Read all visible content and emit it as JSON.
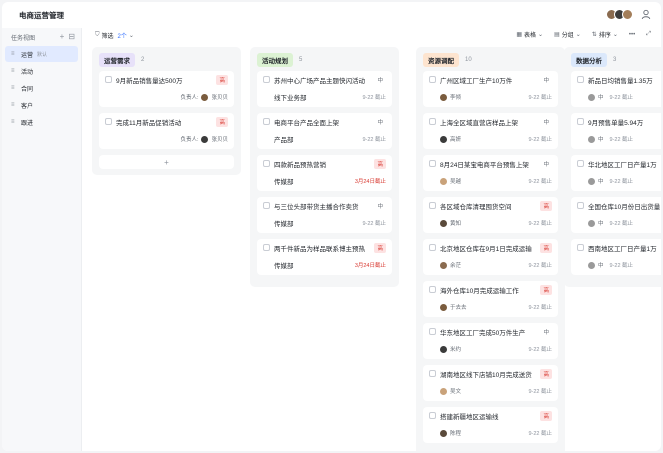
{
  "app": {
    "title": "电商运营管理"
  },
  "header": {
    "user_icon": "user-icon"
  },
  "sidebar": {
    "title": "任务视图",
    "items": [
      {
        "label": "运营",
        "badge": "默认",
        "active": true
      },
      {
        "label": "活动"
      },
      {
        "label": "合同"
      },
      {
        "label": "客户"
      },
      {
        "label": "跟进"
      }
    ]
  },
  "toolbar": {
    "filter_label": "筛选",
    "filter_count": "2个",
    "view_label": "表格",
    "group_label": "分组",
    "sort_label": "排序"
  },
  "columns": [
    {
      "tag": "运营需求",
      "count": "2",
      "tag_color": "#e7e1f9",
      "cards": [
        {
          "title": "9月新品销售量达500万",
          "priority": "高",
          "owner_label": "负责人:",
          "owner": "张贝贝"
        },
        {
          "title": "完成11月新品促销活动",
          "priority": "高",
          "owner_label": "负责人:",
          "owner": "张贝贝"
        }
      ],
      "add_label": "+"
    },
    {
      "tag": "活动规划",
      "count": "5",
      "tag_color": "#dcf2d3",
      "cards": [
        {
          "title": "苏州中心广场产品主题快闪活动",
          "title2": "线下业务部",
          "priority": "中",
          "due": "9-22 截止"
        },
        {
          "title": "电商平台产品全面上架",
          "title2": "产品部",
          "priority": "中",
          "due": "9-22 截止"
        },
        {
          "title": "四款新品预热营销",
          "title2": "传媒部",
          "priority": "高",
          "due": "3月24日截止",
          "overdue": true
        },
        {
          "title": "与三位头部带货主播合作卖货",
          "title2": "传媒部",
          "priority": "中",
          "due": "9-22 截止"
        },
        {
          "title": "两千件新品为样品联系博主预热",
          "title2": "传媒部",
          "priority": "高",
          "due": "3月24日截止",
          "overdue": true
        }
      ]
    },
    {
      "tag": "资源调配",
      "count": "10",
      "tag_color": "#fde4cf",
      "cards": [
        {
          "title": "广州区域工厂生产10万件",
          "priority": "中",
          "person": "李倾",
          "due": "9-22 截止"
        },
        {
          "title": "上海全区域直营店样品上架",
          "priority": "中",
          "person": "高妍",
          "due": "9-22 截止"
        },
        {
          "title": "8月24日某宝电商平台预售上架",
          "priority": "中",
          "person": "吴越",
          "due": "9-22 截止"
        },
        {
          "title": "各区域仓库清理囤货空间",
          "priority": "高",
          "person": "黄知",
          "due": "9-22 截止"
        },
        {
          "title": "北京地区仓库在9月1日完成运输",
          "priority": "高",
          "person": "余茫",
          "due": "9-22 截止"
        },
        {
          "title": "海外仓库10月完成运输工作",
          "priority": "高",
          "person": "于去去",
          "due": "9-22 截止"
        },
        {
          "title": "华东地区工厂完成50万件生产",
          "priority": "中",
          "person": "米约",
          "due": "9-22 截止"
        },
        {
          "title": "湖南地区线下店铺10月完成送货",
          "priority": "高",
          "person": "吴文",
          "due": "9-22 截止"
        },
        {
          "title": "搭建新疆地区运输线",
          "priority": "高",
          "person": "陈程",
          "due": "9-22 截止"
        }
      ]
    },
    {
      "tag": "数据分析",
      "count": "3",
      "tag_color": "#dbe8fb",
      "cards": [
        {
          "title": "新品日均销售量1.35万",
          "level": "中",
          "due": "9-22 截止"
        },
        {
          "title": "9月预售单量5.94万",
          "level": "中",
          "due": "9-22 截止"
        },
        {
          "title": "华北地区工厂日产量1万",
          "level": "中",
          "due": "9-22 截止"
        },
        {
          "title": "全国仓库10月份日出货量",
          "level": "中",
          "due": "9-22 截止"
        },
        {
          "title": "西南地区工厂日产量1万",
          "level": "中",
          "due": "9-22 截止"
        }
      ]
    }
  ],
  "colors": {
    "accent": "#3370ff",
    "danger": "#d83931",
    "avatar_a": "#7a5c3e",
    "avatar_b": "#3b3b3b",
    "avatar_c": "#c9a27a"
  }
}
